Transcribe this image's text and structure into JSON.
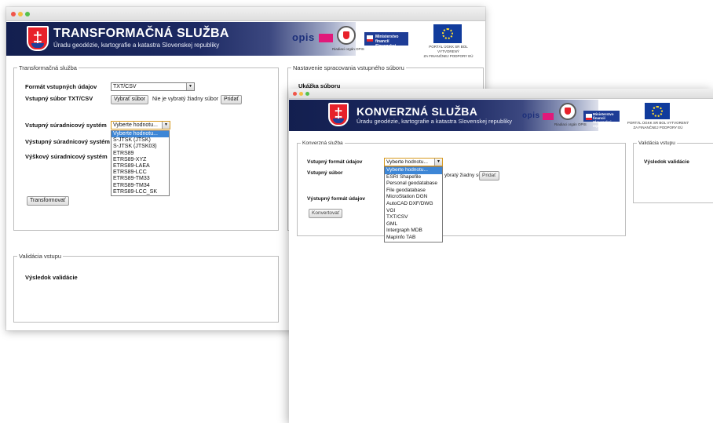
{
  "window_left": {
    "banner": {
      "title": "TRANSFORMAČNÁ SLUŽBA",
      "subtitle": "Úradu geodézie, kartografie a katastra Slovenskej republiky",
      "logo_opis": "opis",
      "seal_caption": "Riadiaci orgán OPIS",
      "ministry_label": "Ministerstvo financií Slovenskej republiky",
      "eu_caption_line1": "PORTÁL ÚGKK SR BOL VYTVORENÝ",
      "eu_caption_line2": "ZA FINANČNEJ PODPORY EÚ"
    },
    "form": {
      "legend": "Transformačná služba",
      "format_label": "Formát vstupných údajov",
      "format_value": "TXT/CSV",
      "file_label": "Vstupný súbor TXT/CSV",
      "choose_file_button": "Vybrať súbor",
      "no_file_text": "Nie je vybratý žiadny súbor",
      "add_button": "Pridať",
      "input_crs_label": "Vstupný súradnicový systém",
      "input_crs_value": "Vyberte hodnotu...",
      "output_crs_label": "Výstupný súradnicový systém",
      "height_crs_label": "Výškový súradnicový systém",
      "transform_button": "Transformovať",
      "crs_options": [
        "Vyberte hodnotu...",
        "S-JTSK (JTSK)",
        "S-JTSK (JTSK03)",
        "ETRS89",
        "ETRS89-XYZ",
        "ETRS89-LAEA",
        "ETRS89-LCC",
        "ETRS89-TM33",
        "ETRS89-TM34",
        "ETRS89-LCC_SK"
      ]
    },
    "settings": {
      "legend": "Nastavenie spracovania vstupného súboru",
      "preview_label": "Ukážka súboru"
    },
    "validation": {
      "legend": "Validácia vstupu",
      "result_label": "Výsledok validácie"
    }
  },
  "window_right": {
    "banner": {
      "title": "KONVERZNÁ SLUŽBA",
      "subtitle": "Úradu geodézie, kartografie a katastra Slovenskej republiky",
      "logo_opis": "opis",
      "seal_caption": "Riadiaci orgán OPIS",
      "ministry_label": "Ministerstvo financií Slovenskej republiky",
      "eu_caption_line1": "PORTÁL ÚGKK SR BOL VYTVORENÝ",
      "eu_caption_line2": "ZA FINANČNEJ PODPORY EÚ"
    },
    "form": {
      "legend": "Konverzná služba",
      "input_format_label": "Vstupný formát údajov",
      "input_format_value": "Vyberte hodnotu...",
      "file_label": "Vstupný súbor",
      "no_file_text_partial": "ybratý žiadny súbor",
      "add_button": "Pridať",
      "output_format_label": "Výstupný formát údajov",
      "convert_button": "Konvertovať",
      "format_options": [
        "Vyberte hodnotu...",
        "ESRI Shapefile",
        "Personal geodatabase",
        "File geodatabase",
        "MicroStation DGN",
        "AutoCAD DXF/DWG",
        "VGI",
        "TXT/CSV",
        "GML",
        "Intergraph MDB",
        "MapInfo TAB"
      ]
    },
    "validation": {
      "legend": "Validácia vstupu",
      "result_label": "Výsledok validácie"
    }
  },
  "colors": {
    "banner_navy": "#1d2a63",
    "shield_red": "#e8212a",
    "selection_blue": "#3d86d6",
    "eu_blue": "#103b9c",
    "opis_pink": "#e1197a"
  }
}
